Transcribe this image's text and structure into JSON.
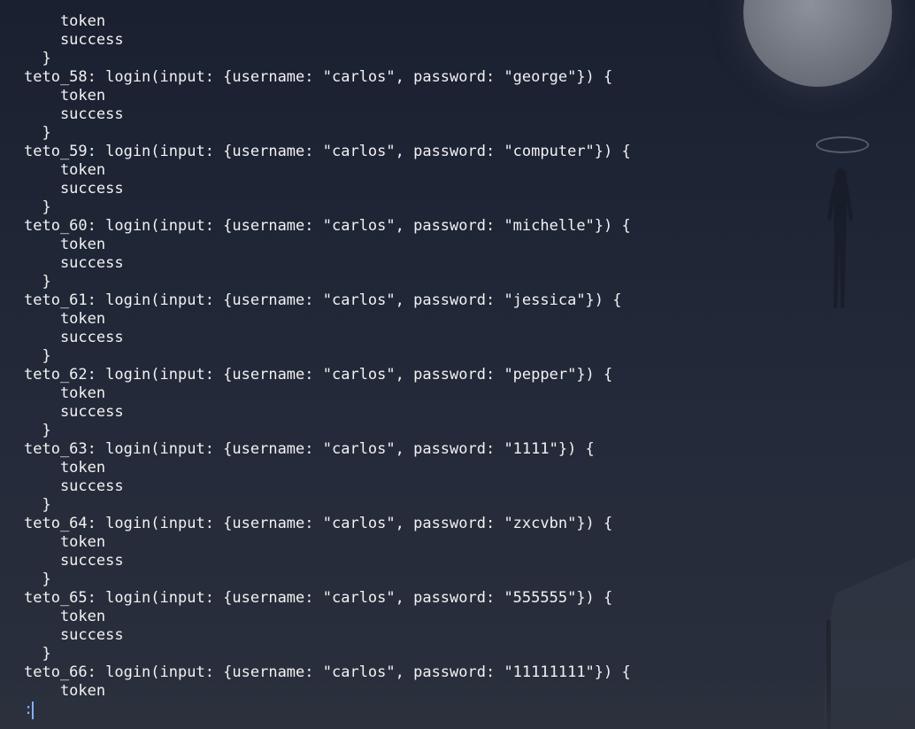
{
  "terminal": {
    "lines": [
      "    token",
      "    success",
      "  }",
      "teto_58: login(input: {username: \"carlos\", password: \"george\"}) {",
      "    token",
      "    success",
      "  }",
      "teto_59: login(input: {username: \"carlos\", password: \"computer\"}) {",
      "    token",
      "    success",
      "  }",
      "teto_60: login(input: {username: \"carlos\", password: \"michelle\"}) {",
      "    token",
      "    success",
      "  }",
      "teto_61: login(input: {username: \"carlos\", password: \"jessica\"}) {",
      "    token",
      "    success",
      "  }",
      "teto_62: login(input: {username: \"carlos\", password: \"pepper\"}) {",
      "    token",
      "    success",
      "  }",
      "teto_63: login(input: {username: \"carlos\", password: \"1111\"}) {",
      "    token",
      "    success",
      "  }",
      "teto_64: login(input: {username: \"carlos\", password: \"zxcvbn\"}) {",
      "    token",
      "    success",
      "  }",
      "teto_65: login(input: {username: \"carlos\", password: \"555555\"}) {",
      "    token",
      "    success",
      "  }",
      "teto_66: login(input: {username: \"carlos\", password: \"11111111\"}) {",
      "    token"
    ],
    "prompt": ":"
  },
  "colors": {
    "text": "#f2f2f2",
    "prompt": "#7fb2ff",
    "background": "#1f2636"
  }
}
